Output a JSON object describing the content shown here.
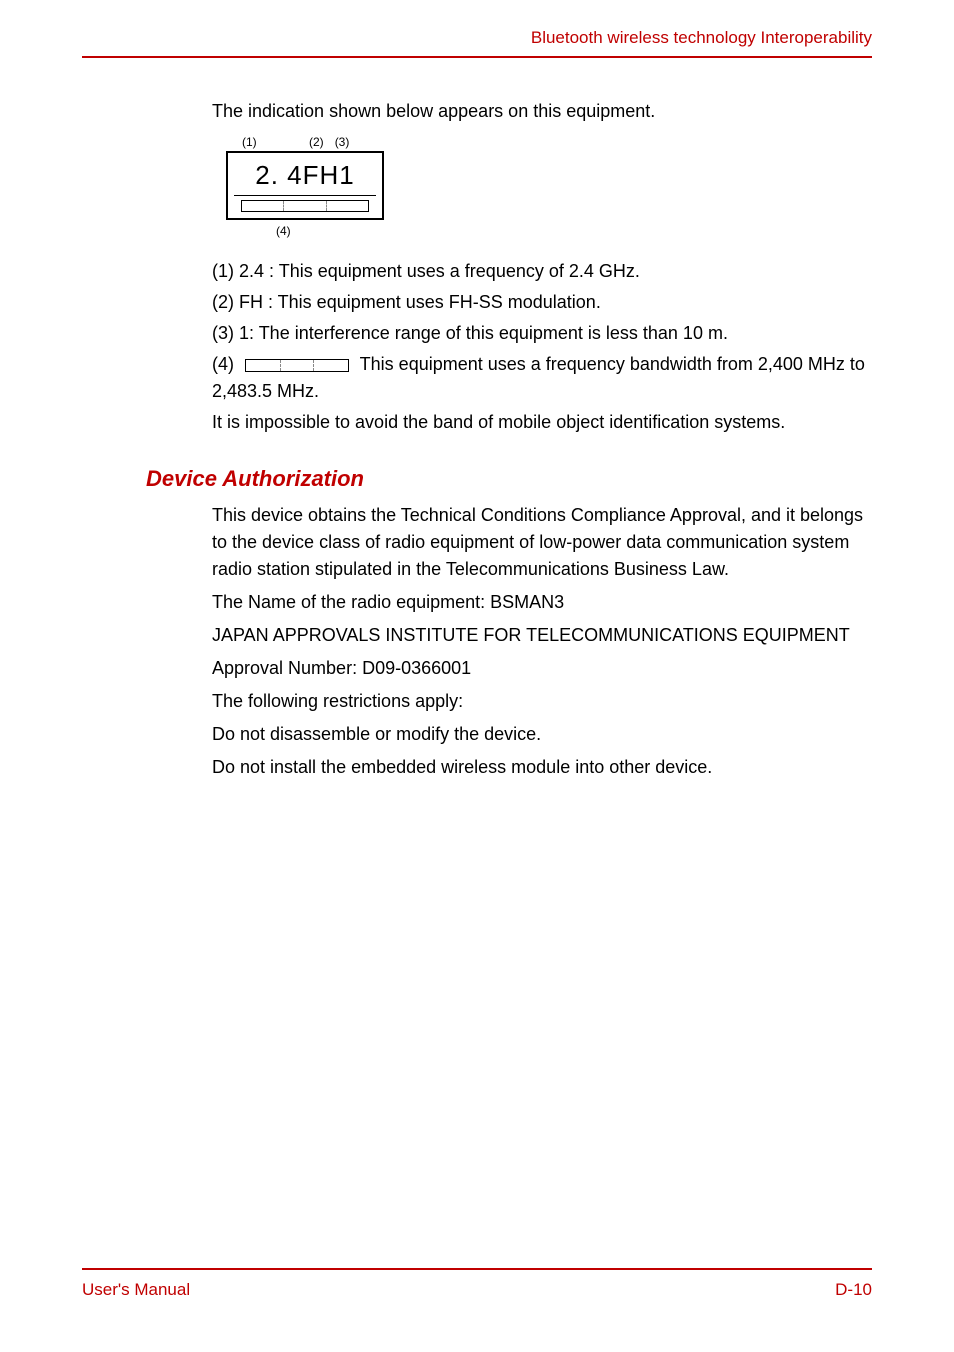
{
  "header": {
    "title": "Bluetooth wireless technology Interoperability"
  },
  "section1": {
    "intro": "The indication shown below appears on this equipment.",
    "label_diagram": {
      "top_labels": {
        "l1": "(1)",
        "l2": "(2)",
        "l3": "(3)"
      },
      "main_text": "2. 4FH1",
      "bottom_label": "(4)"
    },
    "items": {
      "i1": "(1) 2.4 : This equipment uses a frequency of 2.4 GHz.",
      "i2": "(2) FH : This equipment uses FH-SS modulation.",
      "i3": "(3) 1: The interference range of this equipment is less than 10 m.",
      "i4_prefix": "(4) ",
      "i4_suffix": " This equipment uses a frequency bandwidth from 2,400 MHz to 2,483.5 MHz.",
      "tail": "It is impossible to avoid the band of mobile object identification systems."
    }
  },
  "section2": {
    "heading": "Device Authorization",
    "p1": "This device obtains the Technical Conditions Compliance Approval, and it belongs to the device class of radio equipment of low-power data communication system radio station stipulated in the Telecommunications Business Law.",
    "p2": "The Name of the radio equipment: BSMAN3",
    "p3": "JAPAN APPROVALS INSTITUTE FOR TELECOMMUNICATIONS EQUIPMENT",
    "p4": "Approval Number: D09-0366001",
    "p5": "The following restrictions apply:",
    "p6": "Do not disassemble or modify the device.",
    "p7": "Do not install the embedded wireless module into other device."
  },
  "footer": {
    "left": "User's Manual",
    "right": "D-10"
  }
}
